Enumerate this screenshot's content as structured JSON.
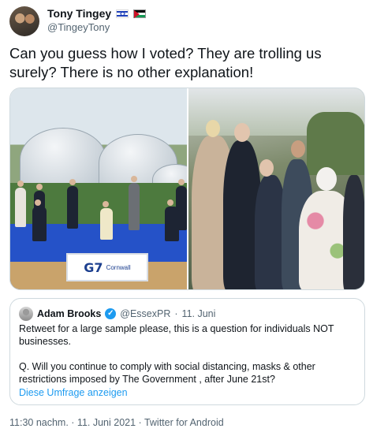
{
  "author": {
    "display_name": "Tony Tingey",
    "handle": "@TingeyTony",
    "flag_icons": [
      "israel-flag-icon",
      "palestine-flag-icon"
    ]
  },
  "tweet": {
    "text": "Can you guess how I voted? They are trolling us surely? There is no other explanation!"
  },
  "media": {
    "left_photo": {
      "sign_main": "G7",
      "sign_sub": "Cornwall"
    }
  },
  "quoted_tweet": {
    "name": "Adam Brooks",
    "handle": "@EssexPR",
    "separator": "·",
    "date": "11. Juni",
    "paragraph_1": "Retweet for a large sample please, this is a question for individuals NOT businesses.",
    "paragraph_2": "Q. Will you continue to comply with social distancing, masks & other restrictions imposed by The Government , after June 21st?",
    "poll_link": "Diese Umfrage anzeigen"
  },
  "meta": {
    "text": "11:30 nachm. · 11. Juni 2021 · Twitter for Android"
  },
  "colors": {
    "link": "#1d9bf0",
    "muted": "#536471",
    "border": "#cfd9de"
  }
}
